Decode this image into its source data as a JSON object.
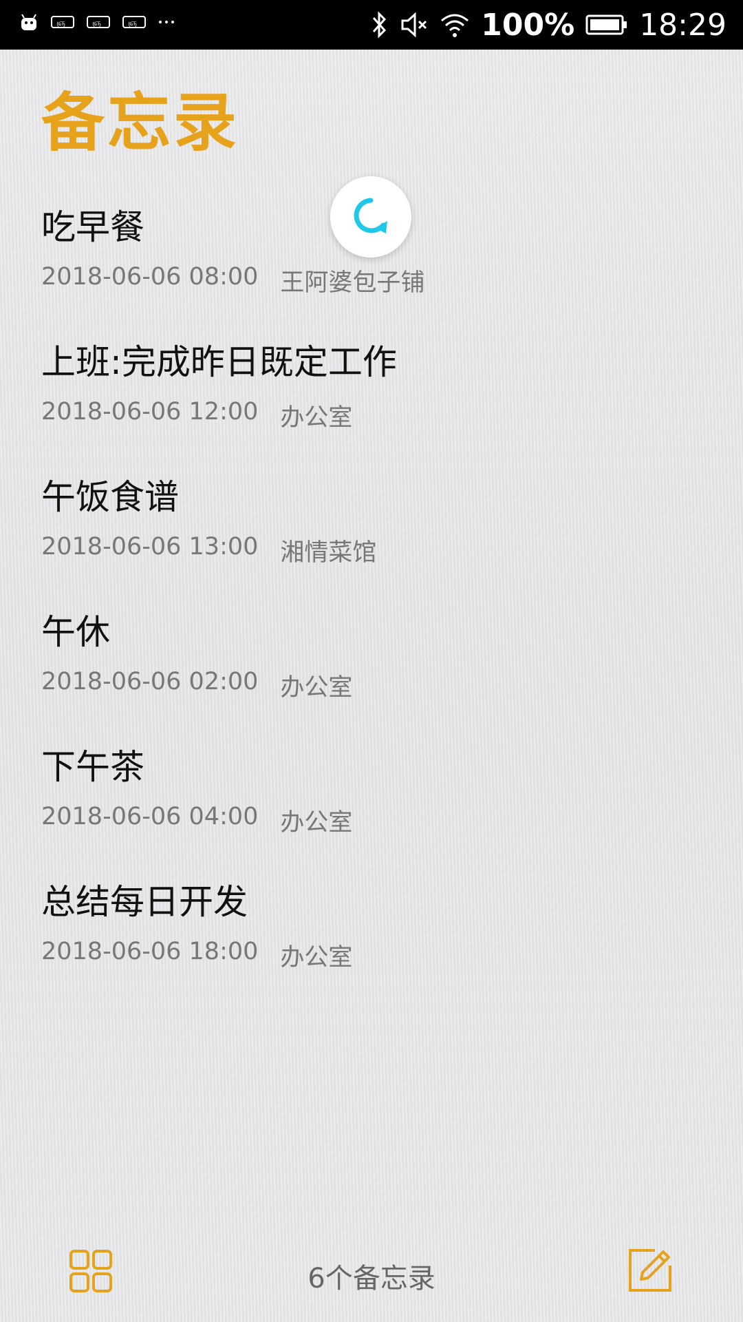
{
  "status_bar": {
    "battery": "100%",
    "time": "18:29",
    "left_icons": [
      "android-icon",
      "notification-icon",
      "notification-icon",
      "notification-icon",
      "more-dots-icon"
    ],
    "right_icons": [
      "bluetooth-icon",
      "mute-icon",
      "wifi-icon",
      "battery-icon"
    ]
  },
  "header": {
    "title": "备忘录"
  },
  "memos": [
    {
      "title": "吃早餐",
      "date": "2018-06-06 08:00",
      "place": "王阿婆包子铺"
    },
    {
      "title": "上班:完成昨日既定工作",
      "date": "2018-06-06 12:00",
      "place": "办公室"
    },
    {
      "title": "午饭食谱",
      "date": "2018-06-06 13:00",
      "place": "湘情菜馆"
    },
    {
      "title": "午休",
      "date": "2018-06-06 02:00",
      "place": "办公室"
    },
    {
      "title": "下午茶",
      "date": "2018-06-06 04:00",
      "place": "办公室"
    },
    {
      "title": "总结每日开发",
      "date": "2018-06-06 18:00",
      "place": "办公室"
    }
  ],
  "footer": {
    "count_label": "6个备忘录"
  },
  "colors": {
    "accent": "#e7a21c",
    "refresh": "#1ec8e8"
  }
}
